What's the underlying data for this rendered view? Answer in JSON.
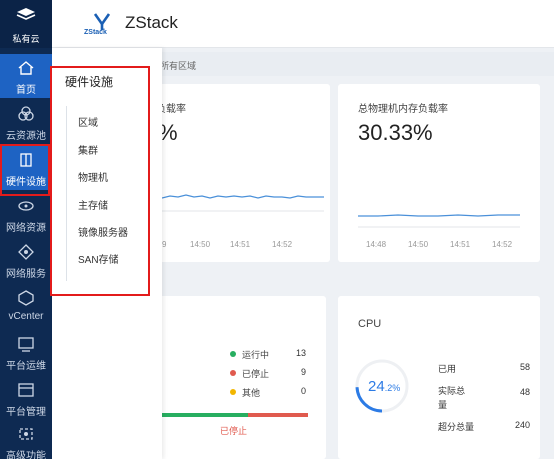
{
  "nav": {
    "top_label": "私有云",
    "items": [
      {
        "label": "首页",
        "icon": "home-icon"
      },
      {
        "label": "云资源池",
        "icon": "cloud-pool-icon"
      },
      {
        "label": "硬件设施",
        "icon": "hardware-icon"
      },
      {
        "label": "网络资源",
        "icon": "network-resource-icon"
      },
      {
        "label": "网络服务",
        "icon": "network-service-icon"
      },
      {
        "label": "vCenter",
        "icon": "vcenter-icon"
      },
      {
        "label": "平台运维",
        "icon": "ops-icon"
      },
      {
        "label": "平台管理",
        "icon": "platform-manage-icon"
      },
      {
        "label": "高级功能",
        "icon": "advanced-icon"
      }
    ]
  },
  "header": {
    "logo_text": "ZStack",
    "brand": "ZStack"
  },
  "breadcrumb": "所有区域",
  "flyout": {
    "title": "硬件设施",
    "items": [
      "区域",
      "集群",
      "物理机",
      "主存储",
      "镜像服务器",
      "SAN存储"
    ]
  },
  "cpu_load_card": {
    "title_partial": "负载率",
    "value_partial": "%",
    "ticks": [
      "9",
      "14:50",
      "14:51",
      "14:52"
    ]
  },
  "mem_load_card": {
    "title": "总物理机内存负载率",
    "value": "30.33%",
    "ticks": [
      "14:48",
      "14:50",
      "14:51",
      "14:52"
    ]
  },
  "vm_status_card": {
    "legend": [
      {
        "label": "运行中",
        "count": "13",
        "color": "#27ae60"
      },
      {
        "label": "已停止",
        "count": "9",
        "color": "#e05a4e"
      },
      {
        "label": "其他",
        "count": "0",
        "color": "#f2b600"
      }
    ],
    "bar_label": "已停止",
    "running": 13,
    "stopped": 9,
    "other": 0
  },
  "cpu_card": {
    "title": "CPU",
    "percent_main": "24",
    "percent_fraction": ".2%",
    "percent": 24.2,
    "rows": [
      {
        "label": "已用",
        "value": "58"
      },
      {
        "label": "实际总",
        "label2": "量",
        "value": "48"
      },
      {
        "label": "超分总量",
        "value": "240"
      }
    ]
  },
  "colors": {
    "nav_bg": "#0e2a52",
    "nav_active": "#1e63c3",
    "accent": "#2c7be5",
    "highlight": "#e31b1b"
  }
}
